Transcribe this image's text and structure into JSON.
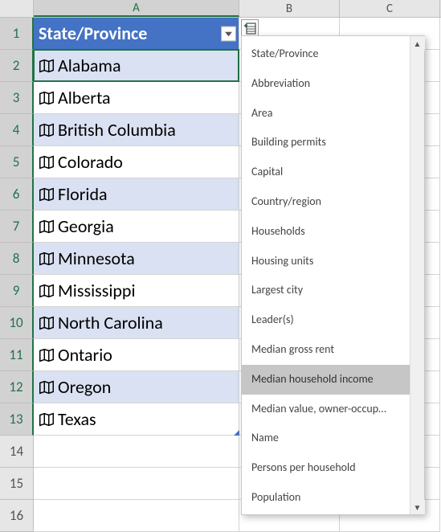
{
  "columnHeaders": {
    "A": "A",
    "B": "B",
    "C": "C"
  },
  "header": {
    "label": "State/Province"
  },
  "rows": [
    {
      "n": "1"
    },
    {
      "n": "2",
      "value": "Alabama",
      "band": "odd"
    },
    {
      "n": "3",
      "value": "Alberta",
      "band": "even"
    },
    {
      "n": "4",
      "value": "British Columbia",
      "band": "odd"
    },
    {
      "n": "5",
      "value": "Colorado",
      "band": "even"
    },
    {
      "n": "6",
      "value": "Florida",
      "band": "odd"
    },
    {
      "n": "7",
      "value": "Georgia",
      "band": "even"
    },
    {
      "n": "8",
      "value": "Minnesota",
      "band": "odd"
    },
    {
      "n": "9",
      "value": "Mississippi",
      "band": "even"
    },
    {
      "n": "10",
      "value": "North Carolina",
      "band": "odd"
    },
    {
      "n": "11",
      "value": "Ontario",
      "band": "even"
    },
    {
      "n": "12",
      "value": "Oregon",
      "band": "odd"
    },
    {
      "n": "13",
      "value": "Texas",
      "band": "even"
    },
    {
      "n": "14"
    },
    {
      "n": "15"
    },
    {
      "n": "16"
    }
  ],
  "dropdown": {
    "items": [
      {
        "label": "State/Province"
      },
      {
        "label": "Abbreviation"
      },
      {
        "label": "Area"
      },
      {
        "label": "Building permits"
      },
      {
        "label": "Capital"
      },
      {
        "label": "Country/region"
      },
      {
        "label": "Households"
      },
      {
        "label": "Housing units"
      },
      {
        "label": "Largest city"
      },
      {
        "label": "Leader(s)"
      },
      {
        "label": "Median gross rent"
      },
      {
        "label": "Median household income",
        "highlight": true
      },
      {
        "label": "Median value, owner-occup…"
      },
      {
        "label": "Name"
      },
      {
        "label": "Persons per household"
      },
      {
        "label": "Population"
      }
    ]
  },
  "activeCell": {
    "row": 2,
    "col": "A"
  }
}
